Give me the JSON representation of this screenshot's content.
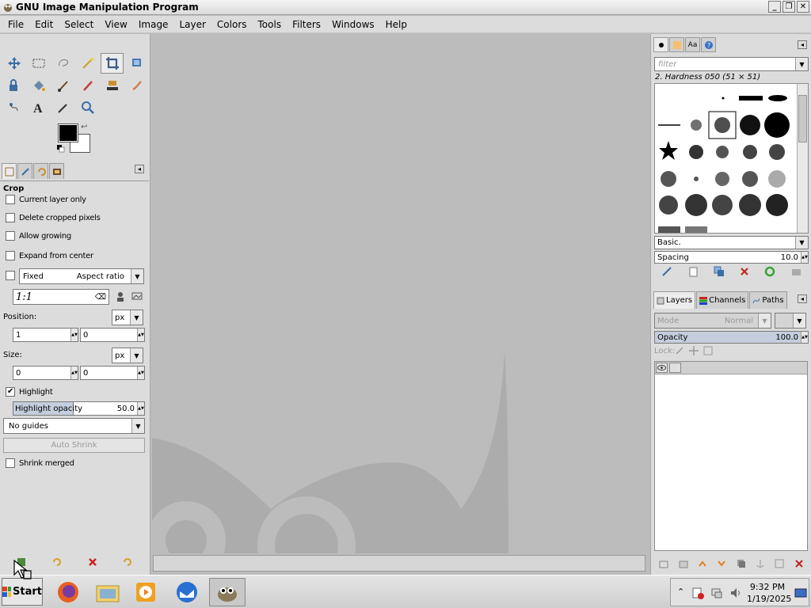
{
  "window": {
    "title": "GNU Image Manipulation Program",
    "controls": [
      "_",
      "❐",
      "✕"
    ]
  },
  "menu": [
    "File",
    "Edit",
    "Select",
    "View",
    "Image",
    "Layer",
    "Colors",
    "Tools",
    "Filters",
    "Windows",
    "Help"
  ],
  "tools": [
    "move-tool",
    "rect-select-tool",
    "free-select-tool",
    "fuzzy-select-tool",
    "crop-tool",
    "unified-transform-tool",
    "warp-transform-tool",
    "bucket-fill-tool",
    "paintbrush-tool",
    "eraser-tool",
    "clone-tool",
    "smudge-tool",
    "paths-tool",
    "text-tool",
    "color-picker-tool",
    "zoom-tool"
  ],
  "tool_options": {
    "title": "Crop",
    "current_layer_only": "Current layer only",
    "delete_cropped": "Delete cropped pixels",
    "allow_growing": "Allow growing",
    "expand_from_center": "Expand from center",
    "fixed_label": "Fixed",
    "fixed_value": "Aspect ratio",
    "ratio": "1:1",
    "position_label": "Position:",
    "position_unit": "px",
    "position_x": "1",
    "position_y": "0",
    "size_label": "Size:",
    "size_unit": "px",
    "size_w": "0",
    "size_h": "0",
    "highlight": "Highlight",
    "highlight_checked": true,
    "highlight_opacity_label": "Highlight opacity",
    "highlight_opacity_value": "50.0",
    "guides": "No guides",
    "auto_shrink": "Auto Shrink",
    "shrink_merged": "Shrink merged"
  },
  "brushes": {
    "filter_placeholder": "filter",
    "selected_brush": "2. Hardness 050 (51 × 51)",
    "preset": "Basic.",
    "spacing_label": "Spacing",
    "spacing_value": "10.0"
  },
  "layers": {
    "tabs": [
      "Layers",
      "Channels",
      "Paths"
    ],
    "mode_label": "Mode",
    "mode_value": "Normal",
    "opacity_label": "Opacity",
    "opacity_value": "100.0",
    "lock_label": "Lock:"
  },
  "taskbar": {
    "start": "Start",
    "time": "9:32 PM",
    "date": "1/19/2025"
  },
  "colors": {
    "foreground": "#000000",
    "background": "#ffffff",
    "canvas_bg": "#bcbcbc",
    "wilber": "#acacac"
  }
}
